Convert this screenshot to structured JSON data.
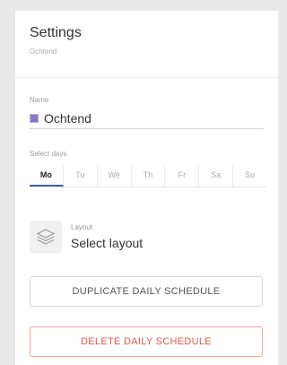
{
  "header": {
    "title": "Settings",
    "subtitle": "Ochtend"
  },
  "name": {
    "label": "Name",
    "value": "Ochtend",
    "color": "#8a78c4"
  },
  "days": {
    "label": "Select days",
    "items": [
      "Mo",
      "Tu",
      "We",
      "Th",
      "Fr",
      "Sa",
      "Su"
    ],
    "active": "Mo"
  },
  "layout": {
    "label": "Layout",
    "value": "Select layout",
    "icon": "layers-icon"
  },
  "buttons": {
    "duplicate": "DUPLICATE DAILY SCHEDULE",
    "delete": "DELETE DAILY SCHEDULE"
  }
}
